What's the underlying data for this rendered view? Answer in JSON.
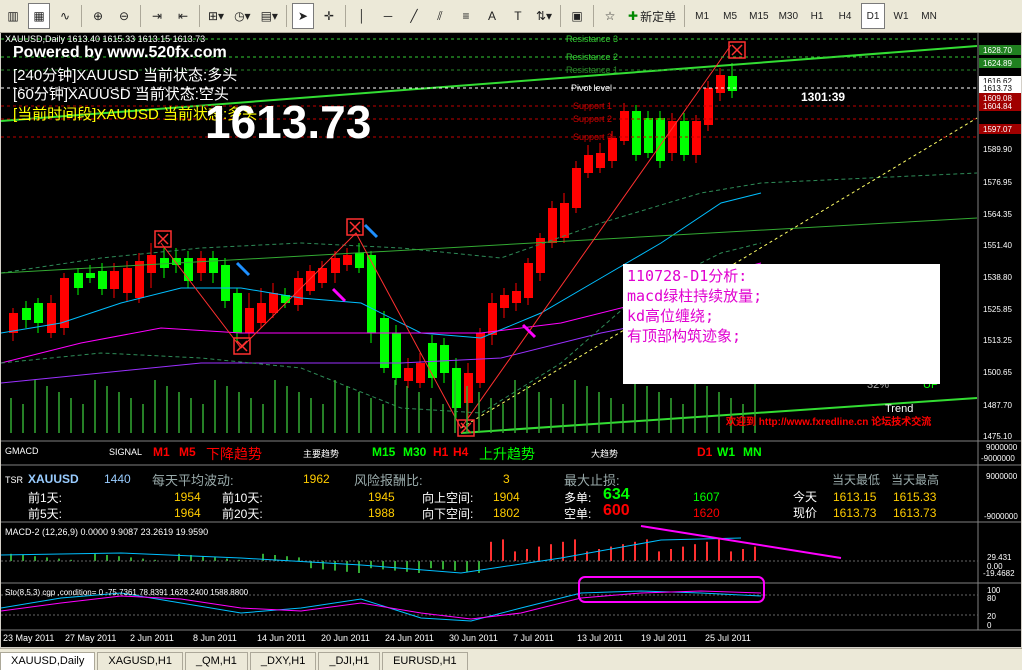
{
  "toolbar": {
    "new_order_label": "新定单",
    "timeframes": [
      "M1",
      "M5",
      "M15",
      "M30",
      "H1",
      "H4",
      "D1",
      "W1",
      "MN"
    ],
    "active_timeframe": "D1"
  },
  "chart": {
    "header": "XAUUSD,Daily  1613.40 1615.33 1613.15 1613.73",
    "watermark": "Powered by www.520fx.com",
    "status_lines": [
      "[240分钟]XAUUSD 当前状态:多头",
      "[60分钟]XAUUSD 当前状态:空头",
      "[当前时间段]XAUUSD 当前状态:多头"
    ],
    "big_price": "1613.73",
    "levels": [
      "Resistance 3",
      "Resistance 2",
      "Resistance 1",
      "Pivot level",
      "Support 1",
      "Support 2",
      "Support 3"
    ],
    "countdown": "1301:39",
    "pct": "32%",
    "up": "UP",
    "trend": "Trend",
    "promo": "欢迎到 http://www.fxredline.cn 论坛技术交流",
    "price_axis": [
      "1628.70",
      "1624.89",
      "1616.62",
      "1613.73",
      "1609.08",
      "1604.84",
      "1597.07",
      "1589.90",
      "1576.95",
      "1564.35",
      "1551.40",
      "1538.80",
      "1525.85",
      "1513.25",
      "1500.65",
      "1487.70",
      "1475.10"
    ],
    "signal_marks": [
      "风",
      "风",
      "风",
      "风"
    ]
  },
  "note": {
    "lines": [
      "110728-D1分析:",
      "macd绿柱持续放量;",
      "kd高位缠绕;",
      "有顶部构筑迹象;"
    ]
  },
  "gmacd": {
    "title": "GMACD",
    "signal": "SIGNAL",
    "m1": "M1",
    "m5": "M5",
    "down_trend": "下降趋势",
    "main_trend": "主要趋势",
    "m15": "M15",
    "m30": "M30",
    "h1": "H1",
    "h4": "H4",
    "up_trend": "上升趋势",
    "big_trend": "大趋势",
    "d1": "D1",
    "w1": "W1",
    "mn": "MN",
    "axis_top": "9000000",
    "axis_bottom": "-9000000"
  },
  "tsr": {
    "title": "TSR",
    "symbol": "XAUUSD",
    "value": "1440",
    "avg_vol_label": "每天平均波动:",
    "avg_vol": "1962",
    "risk_label": "风险报酬比:",
    "risk": "3",
    "max_sl_label": "最大止损:",
    "prev1_label": "前1天:",
    "prev1": "1954",
    "prev10_label": "前10天:",
    "prev10": "1945",
    "prev5_label": "前5天:",
    "prev5": "1964",
    "prev20_label": "前20天:",
    "prev20": "1988",
    "up_space_label": "向上空间:",
    "up_space": "1904",
    "down_space_label": "向下空间:",
    "down_space": "1802",
    "long_label": "多单:",
    "long": "634",
    "long2": "1607",
    "short_label": "空单:",
    "short": "600",
    "short2": "1620",
    "today_low_label": "当天最低",
    "today_high_label": "当天最高",
    "today_label": "今天",
    "now_label": "现价",
    "today_low": "1613.15",
    "today_high": "1615.33",
    "now_low": "1613.73",
    "now_high": "1613.73",
    "axis_top": "9000000",
    "axis_bottom": "-9000000"
  },
  "macd": {
    "label": "MACD-2 (12,26,9) 0.0000 9.9087 23.2619 19.9590",
    "axis_top": "29.431",
    "axis_zero": "0.00",
    "axis_bottom": "-19.4682"
  },
  "sto": {
    "label": "Sto(8,5,3) cgp ,condition= 0  -75.7361 78.8391 1628.2400 1588.8800",
    "axis_top": "100",
    "axis_80": "80",
    "axis_20": "20",
    "axis_bottom": "0"
  },
  "dates": [
    "23 May 2011",
    "27 May 2011",
    "2 Jun 2011",
    "8 Jun 2011",
    "14 Jun 2011",
    "20 Jun 2011",
    "24 Jun 2011",
    "30 Jun 2011",
    "7 Jul 2011",
    "13 Jul 2011",
    "19 Jul 2011",
    "25 Jul 2011"
  ],
  "tabs": [
    "XAUUSD,Daily",
    "XAGUSD,H1",
    "_QM,H1",
    "_DXY,H1",
    "_DJI,H1",
    "EURUSD,H1"
  ],
  "colors": {
    "bull": "#ff0000",
    "bear": "#00ff00",
    "bg": "#000000",
    "grid": "#404040"
  }
}
